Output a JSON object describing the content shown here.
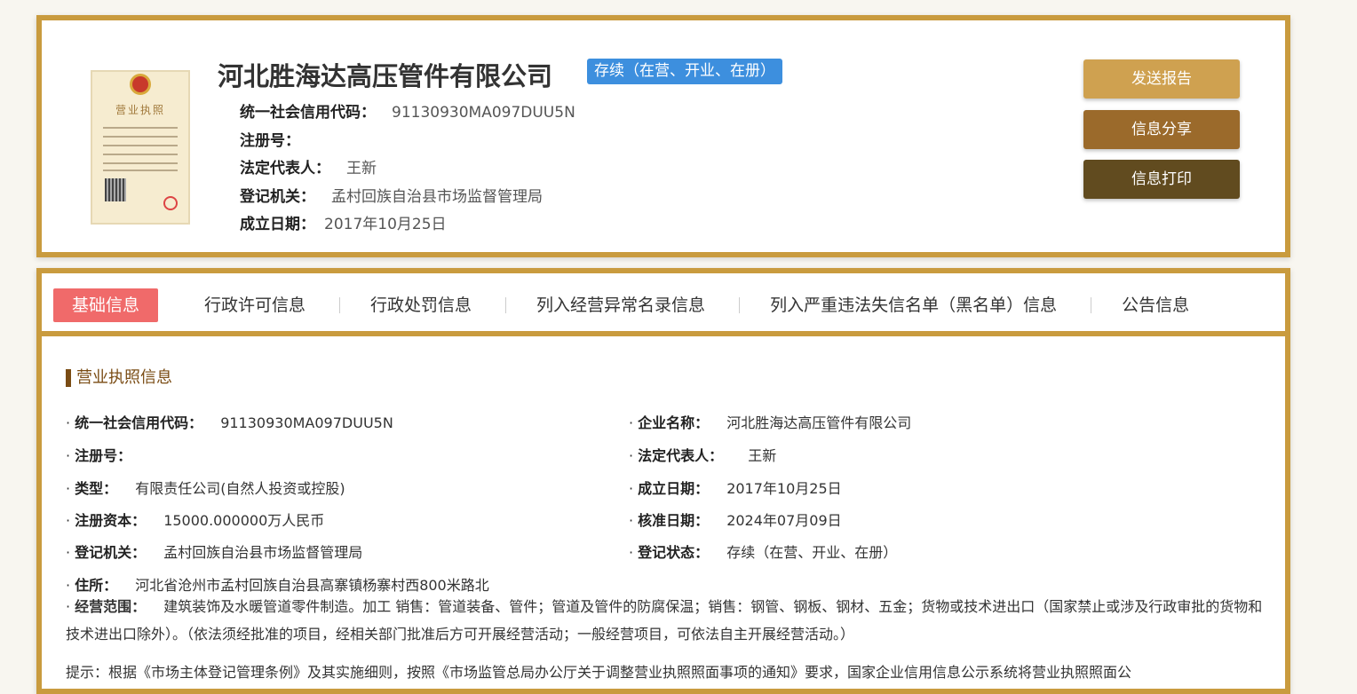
{
  "header": {
    "company_name": "河北胜海达高压管件有限公司",
    "status_badge": "存续（在营、开业、在册）",
    "license_image_label": "营业执照",
    "fields": [
      {
        "label": "统一社会信用代码：",
        "value": "91130930MA097DUU5N"
      },
      {
        "label": "注册号：",
        "value": ""
      },
      {
        "label": "法定代表人：",
        "value": "王新"
      },
      {
        "label": "登记机关：",
        "value": "孟村回族自治县市场监督管理局"
      },
      {
        "label": "成立日期：",
        "value": "2017年10月25日"
      }
    ]
  },
  "actions": {
    "send_report": "发送报告",
    "share": "信息分享",
    "print": "信息打印",
    "colors": [
      "#cfa150",
      "#9b6a2b",
      "#614b1f"
    ]
  },
  "tabs": [
    "基础信息",
    "行政许可信息",
    "行政处罚信息",
    "列入经营异常名录信息",
    "列入严重违法失信名单（黑名单）信息",
    "公告信息"
  ],
  "section": {
    "title": "营业执照信息",
    "left": [
      {
        "label": "统一社会信用代码：",
        "value": "91130930MA097DUU5N"
      },
      {
        "label": "注册号：",
        "value": ""
      },
      {
        "label": "类型：",
        "value": "有限责任公司(自然人投资或控股)"
      },
      {
        "label": "注册资本：",
        "value": "15000.000000万人民币"
      },
      {
        "label": "登记机关：",
        "value": "孟村回族自治县市场监督管理局"
      },
      {
        "label": "住所：",
        "value": "河北省沧州市孟村回族自治县高寨镇杨寨村西800米路北"
      }
    ],
    "right": [
      {
        "label": "企业名称：",
        "value": "河北胜海达高压管件有限公司"
      },
      {
        "label": "法定代表人：",
        "value": "王新"
      },
      {
        "label": "成立日期：",
        "value": "2017年10月25日"
      },
      {
        "label": "核准日期：",
        "value": "2024年07月09日"
      },
      {
        "label": "登记状态：",
        "value": "存续（在营、开业、在册）"
      }
    ],
    "scope_label": "经营范围：",
    "scope_value": "建筑装饰及水暖管道零件制造。加工 销售：管道装备、管件；管道及管件的防腐保温；销售：钢管、钢板、钢材、五金；货物或技术进出口（国家禁止或涉及行政审批的货物和技术进出口除外）。（依法须经批准的项目，经相关部门批准后方可开展经营活动；一般经营项目，可依法自主开展经营活动。）",
    "tip": "提示：根据《市场主体登记管理条例》及其实施细则，按照《市场监管总局办公厅关于调整营业执照照面事项的通知》要求，国家企业信用信息公示系统将营业执照照面公"
  }
}
